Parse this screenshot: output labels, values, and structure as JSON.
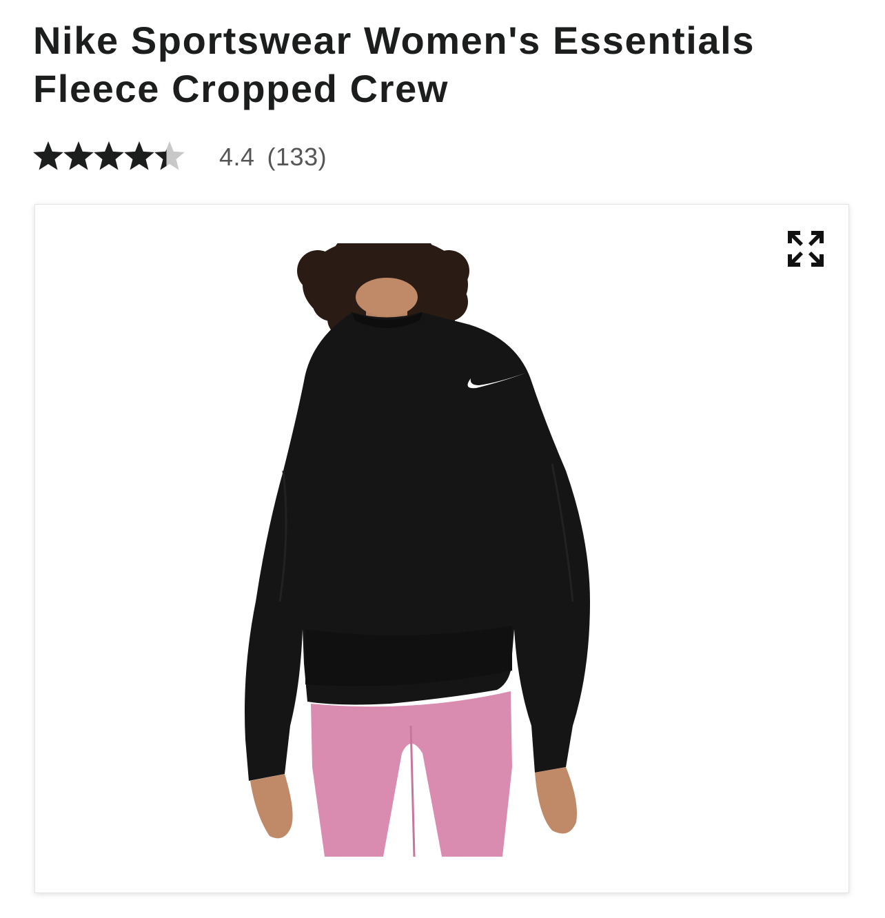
{
  "product": {
    "title": "Nike Sportswear Women's Essentials Fleece Cropped Crew",
    "rating": {
      "stars": 4.4,
      "max_stars": 5,
      "value_text": "4.4",
      "count_text": "(133)"
    }
  },
  "gallery": {
    "expand_icon": "expand-arrows-icon",
    "image_subject": "product-photo",
    "colors": {
      "sweater": "#151515",
      "leggings": "#d98bb0",
      "skin": "#c08a68",
      "hair": "#2a1c14"
    }
  },
  "colors": {
    "star_filled": "#1c1e1d",
    "star_empty": "#c8c8c8",
    "text_muted": "#555555"
  }
}
